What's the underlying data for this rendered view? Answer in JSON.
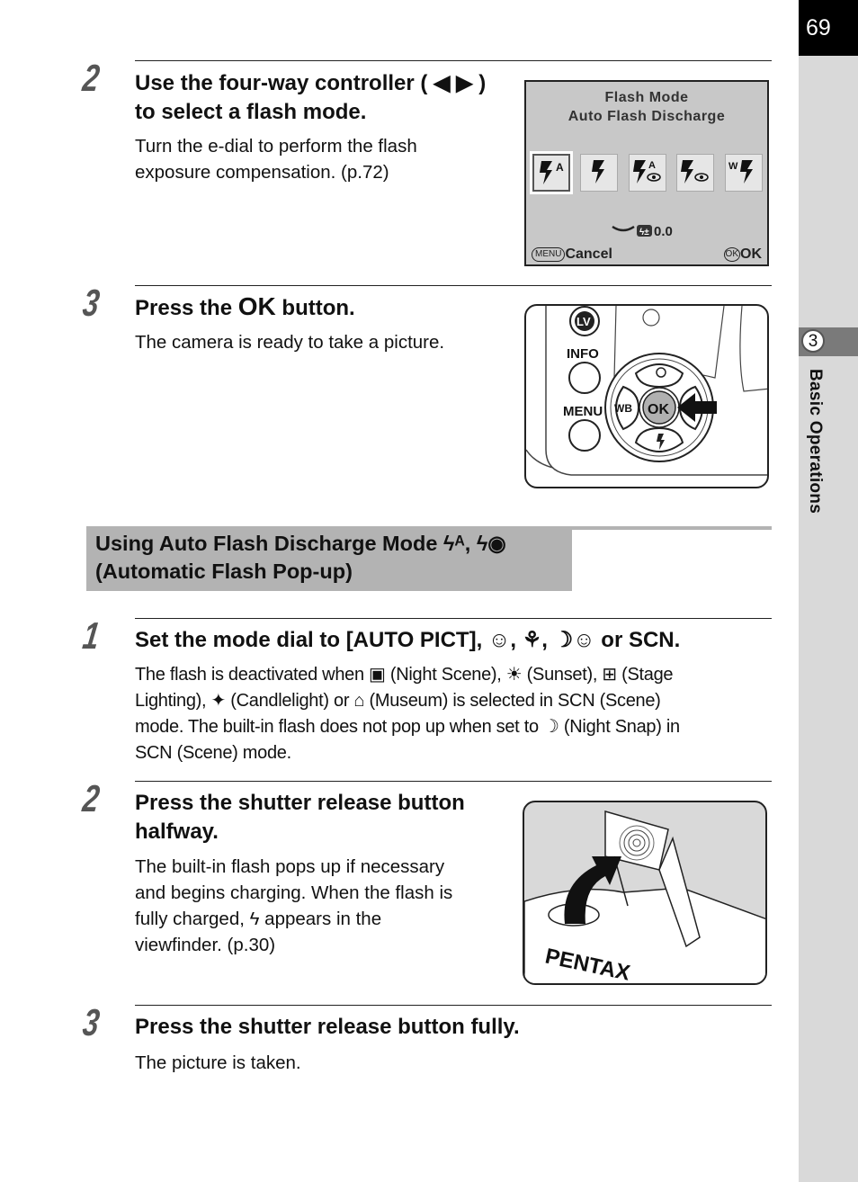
{
  "page": {
    "number": "69",
    "chapter_number": "3",
    "chapter_title": "Basic Operations"
  },
  "step_top_2": {
    "number": "2",
    "title_line1": "Use the four-way controller ( ◀ ▶ )",
    "title_line2": "to select a flash mode.",
    "body_line1": "Turn the e-dial to perform the flash",
    "body_line2": "exposure compensation. (p.72)"
  },
  "lcd": {
    "title": "Flash Mode",
    "subtitle": "Auto Flash Discharge",
    "icons": [
      {
        "name": "auto-flash-discharge",
        "glyph": "ϟA",
        "selected": true
      },
      {
        "name": "flash-on",
        "glyph": "ϟ",
        "selected": false
      },
      {
        "name": "auto-flash-red-eye",
        "glyph": "ϟ◉",
        "selected": false
      },
      {
        "name": "flash-on-red-eye",
        "glyph": "ϟ◎",
        "selected": false
      },
      {
        "name": "wireless",
        "glyph": "Wϟ",
        "selected": false
      }
    ],
    "compensation_value": "0.0",
    "menu_label": "MENU",
    "cancel_label": "Cancel",
    "ok_badge": "OK",
    "ok_label": "OK"
  },
  "step_top_3": {
    "number": "3",
    "title_prefix": "Press the ",
    "title_ok": "OK",
    "title_suffix": " button.",
    "body": "The camera is ready to take a picture."
  },
  "controller_illustration": {
    "lv_label": "LV",
    "info_label": "INFO",
    "menu_label": "MENU",
    "wb_label": "WB",
    "ok_label": "OK"
  },
  "section": {
    "title_line1": "Using Auto Flash Discharge Mode ϟᴬ, ϟ◉",
    "title_line2": "(Automatic Flash Pop-up)"
  },
  "step_1": {
    "number": "1",
    "title": "Set the mode dial to [AUTO PICT], ☺, ⚘, ☽☺ or SCN.",
    "body_lines": [
      "The flash is deactivated when ▣ (Night Scene), ☀ (Sunset), ⊞ (Stage",
      "Lighting), ✦ (Candlelight) or ⌂ (Museum) is selected in SCN (Scene)",
      "mode. The built-in flash does not pop up when set to ☽ (Night Snap) in",
      "SCN (Scene) mode."
    ]
  },
  "step_2": {
    "number": "2",
    "title_line1": "Press the shutter release button",
    "title_line2": "halfway.",
    "body_lines": [
      "The built-in flash pops up if necessary",
      "and begins charging. When the flash is",
      "fully charged, ϟ appears in the",
      "viewfinder. (p.30)"
    ]
  },
  "flash_illustration": {
    "brand": "PENTAX"
  },
  "step_3": {
    "number": "3",
    "title": "Press the shutter release button fully.",
    "body": "The picture is taken."
  }
}
